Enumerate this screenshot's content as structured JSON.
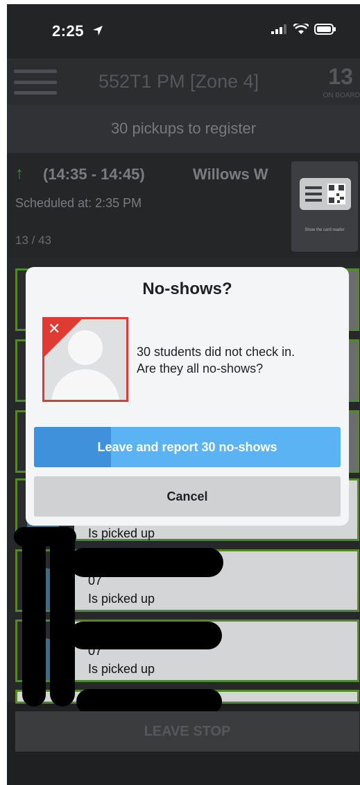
{
  "status_bar": {
    "time": "2:25"
  },
  "header": {
    "route_title": "552T1 PM [Zone 4]",
    "onboard_count": "13",
    "onboard_label": "ON BOARD"
  },
  "pickups_bar": {
    "text": "30 pickups to register"
  },
  "stop": {
    "time_window": "(14:35 - 14:45)",
    "name": "Willows W",
    "scheduled": "Scheduled at: 2:35 PM",
    "progress": "13 / 43",
    "card_reader_label": "Show the card reader"
  },
  "students": [
    {
      "grade": "",
      "status": "Is picked up"
    },
    {
      "grade": "07",
      "status": "Is picked up"
    },
    {
      "grade": "07",
      "status": "Is picked up"
    }
  ],
  "footer": {
    "leave_stop_label": "LEAVE STOP"
  },
  "modal": {
    "title": "No-shows?",
    "message_line1": "30 students did not check in.",
    "message_line2": "Are they all no-shows?",
    "report_label": "Leave and report 30 no-shows",
    "report_progress": 0.25,
    "cancel_label": "Cancel"
  },
  "colors": {
    "accent_blue": "#5cb3f4",
    "accent_blue_dark": "#3f91dc",
    "no_show_red": "#e03b32",
    "status_green": "#4f8a2d"
  }
}
